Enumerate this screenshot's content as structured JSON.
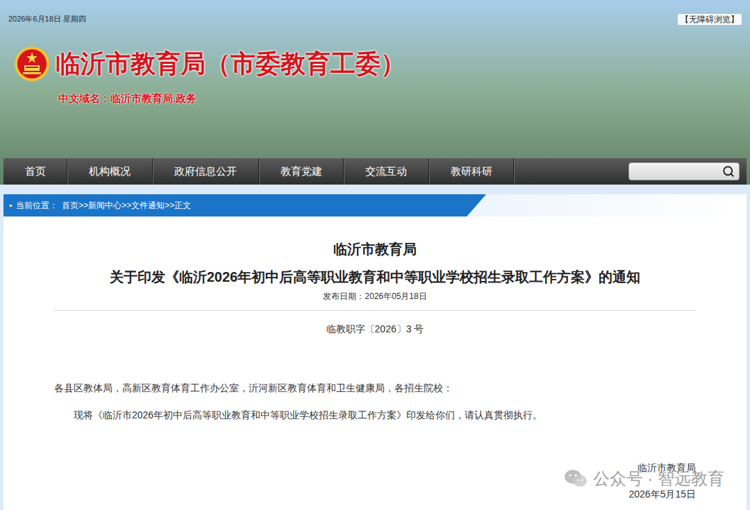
{
  "header": {
    "date": "2026年6月18日  星期四",
    "accessibility": "【无障碍浏览】",
    "site_title": "临沂市教育局（市委教育工委）",
    "domain": "中文域名：临沂市教育局.政务"
  },
  "nav": {
    "items": [
      {
        "label": "首页",
        "selected": false
      },
      {
        "label": "机构概况",
        "selected": false
      },
      {
        "label": "政府信息公开",
        "selected": false
      },
      {
        "label": "教育党建",
        "selected": false
      },
      {
        "label": "交流互动",
        "selected": false
      },
      {
        "label": "教研科研",
        "selected": false
      }
    ]
  },
  "breadcrumb": {
    "label": "当前位置：",
    "path": "首页>>新闻中心>>文件通知>>正文"
  },
  "article": {
    "org": "临沂市教育局",
    "title": "关于印发《临沂2026年初中后高等职业教育和中等职业学校招生录取工作方案》的通知",
    "publish_date": "发布日期：2026年05月18日",
    "doc_number": "临教职字〔2026〕3 号",
    "addressee": "各县区教体局，高新区教育体育工作办公室，沂河新区教育体育和卫生健康局，各招生院校：",
    "body": [
      "现将《临沂市2026年初中后高等职业教育和中等职业学校招生录取工作方案》印发给你们，请认真贯彻执行。"
    ],
    "signature": "临沂市教育局",
    "signed_date": "2026年5月15日"
  },
  "watermark": {
    "text": "公众号 · 智远教育"
  }
}
